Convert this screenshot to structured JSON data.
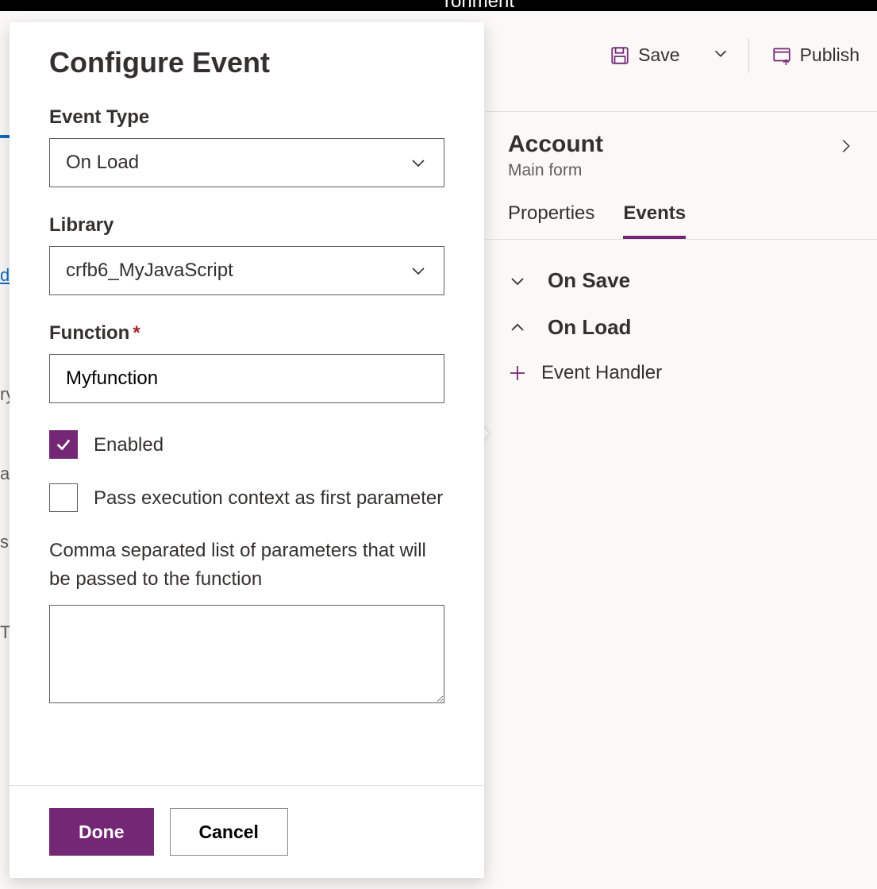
{
  "colors": {
    "accent": "#742774"
  },
  "topbar_fragment": "ronment",
  "command_bar": {
    "save_label": "Save",
    "publish_label": "Publish"
  },
  "right_panel": {
    "title": "Account",
    "subtitle": "Main form",
    "tabs": {
      "properties": "Properties",
      "events": "Events",
      "active": "events"
    },
    "sections": {
      "on_save": {
        "label": "On Save",
        "expanded": false
      },
      "on_load": {
        "label": "On Load",
        "expanded": true
      }
    },
    "add_handler_label": "Event Handler"
  },
  "flyout": {
    "title": "Configure Event",
    "event_type": {
      "label": "Event Type",
      "value": "On Load"
    },
    "library": {
      "label": "Library",
      "value": "crfb6_MyJavaScript"
    },
    "function": {
      "label": "Function",
      "required": true,
      "value": "Myfunction"
    },
    "enabled": {
      "label": "Enabled",
      "checked": true
    },
    "pass_context": {
      "label": "Pass execution context as first parameter",
      "checked": false
    },
    "params": {
      "label": "Comma separated list of parameters that will be passed to the function",
      "value": ""
    },
    "buttons": {
      "done": "Done",
      "cancel": "Cancel"
    }
  },
  "bg_fragments": {
    "di": "di",
    "ry": "ry",
    "ai": "ai",
    "sir": "sir",
    "ts": "TS"
  }
}
